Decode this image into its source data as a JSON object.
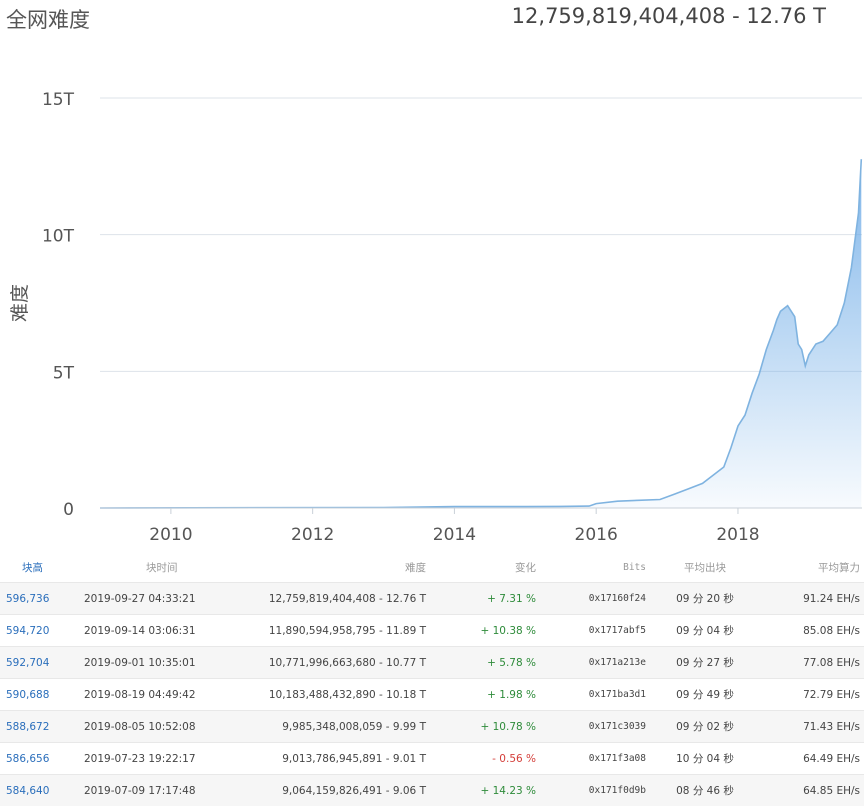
{
  "header": {
    "title": "全网难度",
    "value": "12,759,819,404,408",
    "dash": " - ",
    "value_short": "12.76 T"
  },
  "chart_data": {
    "type": "area",
    "title": "",
    "ylabel": "难度",
    "xlabel": "",
    "ylim": [
      0,
      15
    ],
    "xlim": [
      2009.0,
      2019.75
    ],
    "y_ticks": [
      {
        "value": 0,
        "label": "0"
      },
      {
        "value": 5,
        "label": "5T"
      },
      {
        "value": 10,
        "label": "10T"
      },
      {
        "value": 15,
        "label": "15T"
      }
    ],
    "x_ticks": [
      {
        "value": 2010,
        "label": "2010"
      },
      {
        "value": 2012,
        "label": "2012"
      },
      {
        "value": 2014,
        "label": "2014"
      },
      {
        "value": 2016,
        "label": "2016"
      },
      {
        "value": 2018,
        "label": "2018"
      }
    ],
    "grid": true,
    "series": [
      {
        "color": "#7fb3e0",
        "x": [
          2009.0,
          2013.0,
          2014.0,
          2014.5,
          2015.0,
          2015.5,
          2015.9,
          2016.0,
          2016.3,
          2016.6,
          2016.9,
          2017.1,
          2017.3,
          2017.5,
          2017.65,
          2017.8,
          2017.9,
          2018.0,
          2018.1,
          2018.2,
          2018.3,
          2018.4,
          2018.5,
          2018.55,
          2018.6,
          2018.7,
          2018.8,
          2018.85,
          2018.9,
          2018.95,
          2019.0,
          2019.1,
          2019.2,
          2019.3,
          2019.4,
          2019.5,
          2019.6,
          2019.7,
          2019.74
        ],
        "values": [
          0,
          0.02,
          0.05,
          0.05,
          0.05,
          0.06,
          0.07,
          0.16,
          0.25,
          0.28,
          0.31,
          0.5,
          0.7,
          0.9,
          1.2,
          1.5,
          2.2,
          3.0,
          3.4,
          4.2,
          4.9,
          5.8,
          6.5,
          6.9,
          7.2,
          7.4,
          7.0,
          6.0,
          5.8,
          5.2,
          5.6,
          6.0,
          6.1,
          6.4,
          6.7,
          7.5,
          8.8,
          10.8,
          12.76
        ]
      }
    ]
  },
  "table": {
    "columns": [
      "块高",
      "块时间",
      "难度",
      "变化",
      "Bits",
      "平均出块",
      "平均算力"
    ],
    "rows": [
      {
        "height": "596,736",
        "time": "2019-09-27 04:33:21",
        "difficulty": "12,759,819,404,408 - 12.76 T",
        "change": "+ 7.31 %",
        "change_dir": "pos",
        "bits": "0x17160f24",
        "avg_block": "09 分 20 秒",
        "hashrate": "91.24 EH/s"
      },
      {
        "height": "594,720",
        "time": "2019-09-14 03:06:31",
        "difficulty": "11,890,594,958,795 - 11.89 T",
        "change": "+ 10.38 %",
        "change_dir": "pos",
        "bits": "0x1717abf5",
        "avg_block": "09 分 04 秒",
        "hashrate": "85.08 EH/s"
      },
      {
        "height": "592,704",
        "time": "2019-09-01 10:35:01",
        "difficulty": "10,771,996,663,680 - 10.77 T",
        "change": "+ 5.78 %",
        "change_dir": "pos",
        "bits": "0x171a213e",
        "avg_block": "09 分 27 秒",
        "hashrate": "77.08 EH/s"
      },
      {
        "height": "590,688",
        "time": "2019-08-19 04:49:42",
        "difficulty": "10,183,488,432,890 - 10.18 T",
        "change": "+ 1.98 %",
        "change_dir": "pos",
        "bits": "0x171ba3d1",
        "avg_block": "09 分 49 秒",
        "hashrate": "72.79 EH/s"
      },
      {
        "height": "588,672",
        "time": "2019-08-05 10:52:08",
        "difficulty": "9,985,348,008,059 - 9.99 T",
        "change": "+ 10.78 %",
        "change_dir": "pos",
        "bits": "0x171c3039",
        "avg_block": "09 分 02 秒",
        "hashrate": "71.43 EH/s"
      },
      {
        "height": "586,656",
        "time": "2019-07-23 19:22:17",
        "difficulty": "9,013,786,945,891 - 9.01 T",
        "change": "- 0.56 %",
        "change_dir": "neg",
        "bits": "0x171f3a08",
        "avg_block": "10 分 04 秒",
        "hashrate": "64.49 EH/s"
      },
      {
        "height": "584,640",
        "time": "2019-07-09 17:17:48",
        "difficulty": "9,064,159,826,491 - 9.06 T",
        "change": "+ 14.23 %",
        "change_dir": "pos",
        "bits": "0x171f0d9b",
        "avg_block": "08 分 46 秒",
        "hashrate": "64.85 EH/s"
      }
    ]
  }
}
